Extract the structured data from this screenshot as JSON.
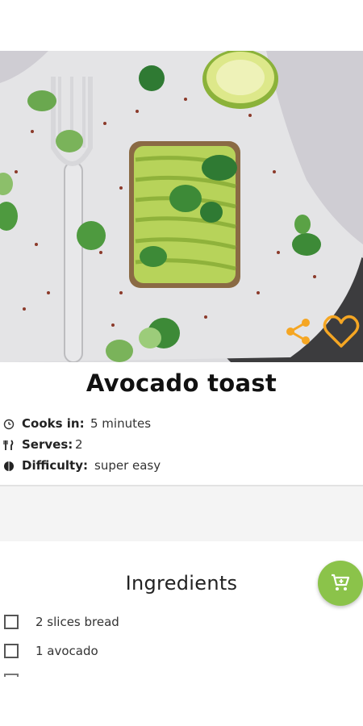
{
  "recipe": {
    "title": "Avocado toast",
    "cooks_label": "Cooks in:",
    "cooks_value": "5 minutes",
    "serves_label": "Serves:",
    "serves_value": "2",
    "difficulty_label": "Difficulty:",
    "difficulty_value": "super easy"
  },
  "ingredients": {
    "title": "Ingredients",
    "items": [
      {
        "label": "2 slices bread",
        "checked": false
      },
      {
        "label": "1 avocado",
        "checked": false
      }
    ]
  },
  "icons": {
    "share": "share-icon",
    "favorite": "heart-outline-icon",
    "cart": "shopping-cart-icon",
    "clock": "clock-icon",
    "cutlery": "cutlery-icon",
    "difficulty": "difficulty-icon"
  },
  "colors": {
    "accent": "#f5a623",
    "fab": "#8bc34a",
    "text": "#111111"
  }
}
